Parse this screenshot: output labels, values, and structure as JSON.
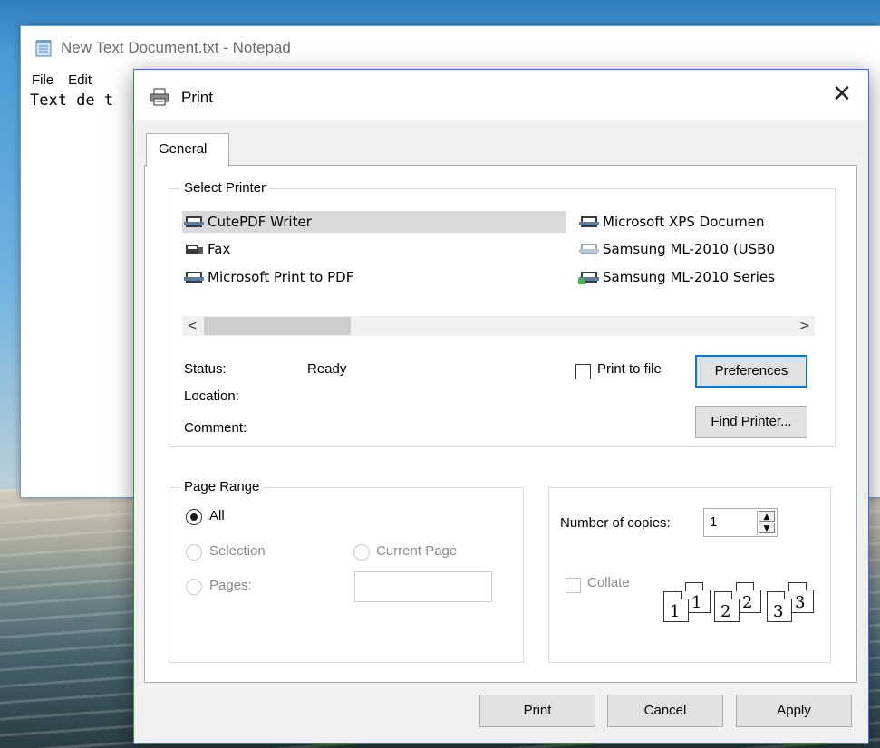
{
  "notepad": {
    "title": "New Text Document.txt - Notepad",
    "menu": [
      "File",
      "Edit"
    ],
    "text": "Text de t"
  },
  "dialog": {
    "title": "Print",
    "close_glyph": "✕",
    "tab": "General",
    "select_printer": {
      "label": "Select Printer",
      "printers": [
        {
          "name": "CutePDF Writer",
          "selected": true,
          "icon": "printer-icon"
        },
        {
          "name": "Fax",
          "selected": false,
          "icon": "fax-icon"
        },
        {
          "name": "Microsoft Print to PDF",
          "selected": false,
          "icon": "printer-icon"
        },
        {
          "name": "Microsoft XPS Documen",
          "selected": false,
          "icon": "printer-icon"
        },
        {
          "name": "Samsung ML-2010 (USB0",
          "selected": false,
          "icon": "printer-disabled-icon"
        },
        {
          "name": "Samsung ML-2010 Series",
          "selected": false,
          "icon": "printer-shared-icon"
        }
      ],
      "scroll_left": "<",
      "scroll_right": ">",
      "status_label": "Status:",
      "status_value": "Ready",
      "location_label": "Location:",
      "comment_label": "Comment:",
      "print_to_file_label": "Print to file",
      "print_to_file_checked": false,
      "preferences_button": "Preferences",
      "find_printer_button": "Find Printer..."
    },
    "page_range": {
      "label": "Page Range",
      "all": "All",
      "selection": "Selection",
      "current_page": "Current Page",
      "pages": "Pages:",
      "selected": "All"
    },
    "copies": {
      "label": "Number of copies:",
      "value": "1",
      "collate_label": "Collate",
      "collate_checked": false,
      "collate_pages": [
        "1",
        "1",
        "2",
        "2",
        "3",
        "3"
      ]
    },
    "buttons": {
      "print": "Print",
      "cancel": "Cancel",
      "apply": "Apply"
    }
  },
  "colors": {
    "accent": "#0078d7",
    "selection": "#d9d9d9"
  }
}
